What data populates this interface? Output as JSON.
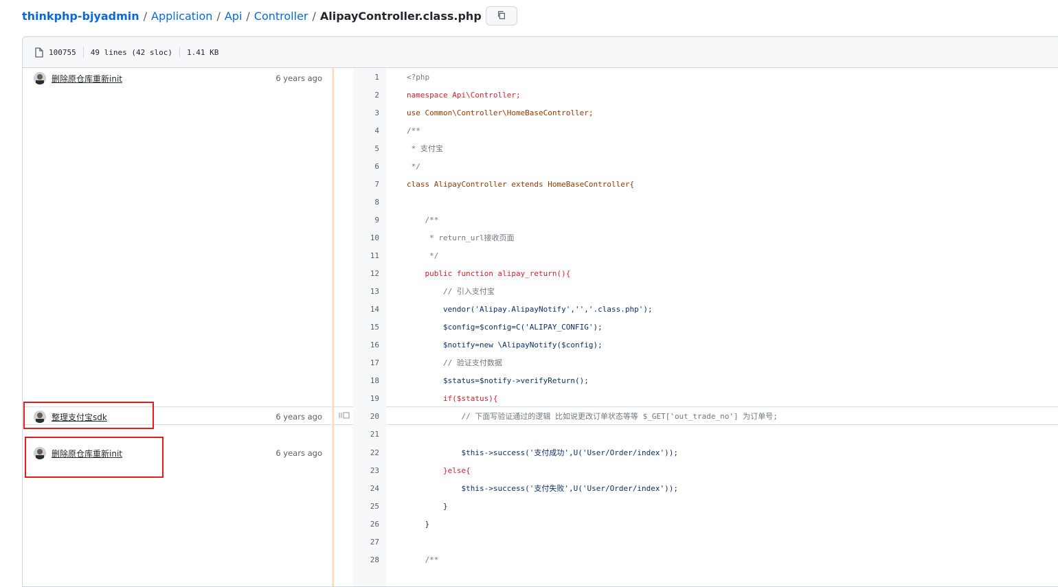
{
  "breadcrumb": {
    "repo": "thinkphp-bjyadmin",
    "parts": [
      "Application",
      "Api",
      "Controller"
    ],
    "file": "AlipayController.class.php",
    "separator": "/"
  },
  "file_info": {
    "mode": "100755",
    "lines": "49 lines (42 sloc)",
    "size": "1.41 KB"
  },
  "hunks": [
    {
      "message": "删除原仓库重新init",
      "age": "6 years ago"
    },
    {
      "message": "整理支付宝sdk",
      "age": "6 years ago"
    },
    {
      "message": "删除原仓库重新init",
      "age": "6 years ago"
    }
  ],
  "lines": [
    {
      "n": "1",
      "code": "<?php"
    },
    {
      "n": "2",
      "code": "namespace Api\\Controller;"
    },
    {
      "n": "3",
      "code": "use Common\\Controller\\HomeBaseController;"
    },
    {
      "n": "4",
      "code": "/**"
    },
    {
      "n": "5",
      "code": " * 支付宝"
    },
    {
      "n": "6",
      "code": " */"
    },
    {
      "n": "7",
      "code": "class AlipayController extends HomeBaseController{"
    },
    {
      "n": "8",
      "code": ""
    },
    {
      "n": "9",
      "code": "    /**"
    },
    {
      "n": "10",
      "code": "     * return_url接收页面"
    },
    {
      "n": "11",
      "code": "     */"
    },
    {
      "n": "12",
      "code": "    public function alipay_return(){"
    },
    {
      "n": "13",
      "code": "        // 引入支付宝"
    },
    {
      "n": "14",
      "code": "        vendor('Alipay.AlipayNotify','','.class.php');"
    },
    {
      "n": "15",
      "code": "        $config=$config=C('ALIPAY_CONFIG');"
    },
    {
      "n": "16",
      "code": "        $notify=new \\AlipayNotify($config);"
    },
    {
      "n": "17",
      "code": "        // 验证支付数据"
    },
    {
      "n": "18",
      "code": "        $status=$notify->verifyReturn();"
    },
    {
      "n": "19",
      "code": "        if($status){"
    },
    {
      "n": "20",
      "code": "            // 下面写验证通过的逻辑 比如说更改订单状态等等 $_GET['out_trade_no'] 为订单号;"
    },
    {
      "n": "21",
      "code": ""
    },
    {
      "n": "22",
      "code": "            $this->success('支付成功',U('User/Order/index'));"
    },
    {
      "n": "23",
      "code": "        }else{"
    },
    {
      "n": "24",
      "code": "            $this->success('支付失败',U('User/Order/index'));"
    },
    {
      "n": "25",
      "code": "        }"
    },
    {
      "n": "26",
      "code": "    }"
    },
    {
      "n": "27",
      "code": ""
    },
    {
      "n": "28",
      "code": "    /**"
    }
  ],
  "colors": {
    "link": "#0969da",
    "highlight_border": "#e51c1c",
    "heat": "#ffd8b5"
  },
  "icons": {
    "copy": "copy-icon",
    "file": "file-icon",
    "reblame": "reblame-icon"
  }
}
